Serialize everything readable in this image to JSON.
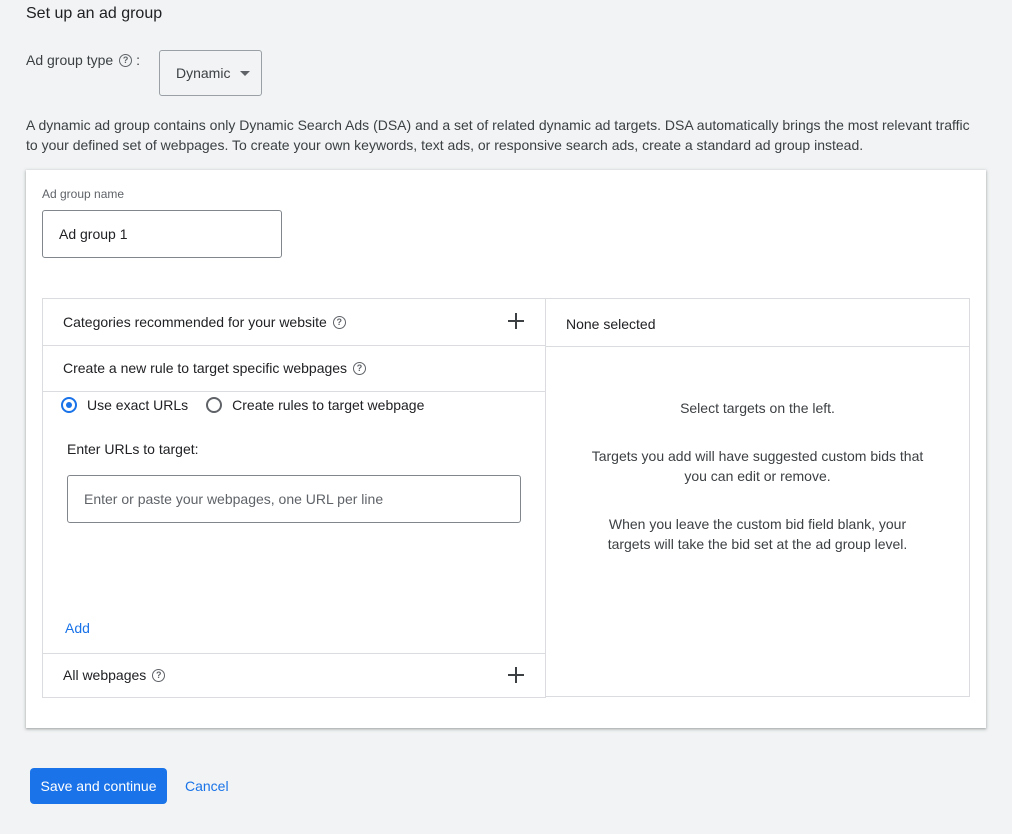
{
  "page_title": "Set up an ad group",
  "ad_group_type": {
    "label": "Ad group type",
    "suffix": ":",
    "selected": "Dynamic"
  },
  "description": "A dynamic ad group contains only Dynamic Search Ads (DSA) and a set of related dynamic ad targets. DSA automatically brings the most relevant traffic to your defined set of webpages. To create your own keywords, text ads, or responsive search ads, create a standard ad group instead.",
  "ad_group_name": {
    "label": "Ad group name",
    "value": "Ad group 1"
  },
  "targets": {
    "categories_label": "Categories recommended for your website",
    "new_rule_label": "Create a new rule to target specific webpages",
    "radio_exact": "Use exact URLs",
    "radio_rules": "Create rules to target webpage",
    "enter_urls_label": "Enter URLs to target:",
    "url_placeholder": "Enter or paste your webpages, one URL per line",
    "add_label": "Add",
    "all_webpages_label": "All webpages"
  },
  "selected_panel": {
    "header": "None selected",
    "line1": "Select targets on the left.",
    "line2": "Targets you add will have suggested custom bids that you can edit or remove.",
    "line3": "When you leave the custom bid field blank, your targets will take the bid set at the ad group level."
  },
  "actions": {
    "save_label": "Save and continue",
    "cancel_label": "Cancel"
  },
  "colors": {
    "accent": "#1a73e8",
    "background": "#f1f3f4"
  }
}
